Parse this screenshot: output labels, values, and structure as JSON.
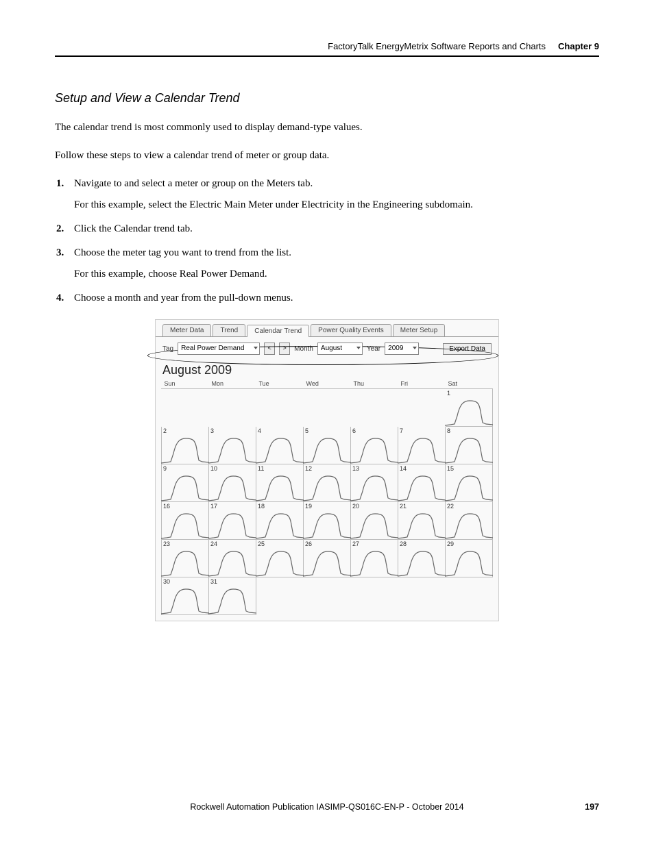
{
  "header": {
    "doc_title": "FactoryTalk EnergyMetrix Software Reports and Charts",
    "chapter": "Chapter 9"
  },
  "section_title": "Setup and View a Calendar Trend",
  "paragraphs": {
    "intro1": "The calendar trend is most commonly used to display demand-type values.",
    "intro2": "Follow these steps to view a calendar trend of meter or group data."
  },
  "steps": [
    {
      "main": "Navigate to and select a meter or group on the Meters tab.",
      "sub": "For this example, select the Electric Main Meter under Electricity in the Engineering subdomain."
    },
    {
      "main": "Click the Calendar trend tab.",
      "sub": ""
    },
    {
      "main": "Choose the meter tag you want to trend from the list.",
      "sub": "For this example, choose Real Power Demand."
    },
    {
      "main": "Choose a month and year from the pull-down menus.",
      "sub": ""
    }
  ],
  "screenshot": {
    "tabs": [
      "Meter Data",
      "Trend",
      "Calendar Trend",
      "Power Quality Events",
      "Meter Setup"
    ],
    "active_tab_index": 2,
    "toolbar": {
      "tag_label": "Tag",
      "tag_value": "Real Power Demand",
      "prev": "<",
      "next": ">",
      "month_label": "Month",
      "month_value": "August",
      "year_label": "Year",
      "year_value": "2009",
      "export": "Export Data"
    },
    "month_title": "August 2009",
    "weekdays": [
      "Sun",
      "Mon",
      "Tue",
      "Wed",
      "Thu",
      "Fri",
      "Sat"
    ],
    "grid": [
      [
        null,
        null,
        null,
        null,
        null,
        null,
        1
      ],
      [
        2,
        3,
        4,
        5,
        6,
        7,
        8
      ],
      [
        9,
        10,
        11,
        12,
        13,
        14,
        15
      ],
      [
        16,
        17,
        18,
        19,
        20,
        21,
        22
      ],
      [
        23,
        24,
        25,
        26,
        27,
        28,
        29
      ],
      [
        30,
        31,
        null,
        null,
        null,
        null,
        null
      ]
    ]
  },
  "footer": {
    "publication": "Rockwell Automation Publication IASIMP-QS016C-EN-P - October 2014",
    "page": "197"
  }
}
